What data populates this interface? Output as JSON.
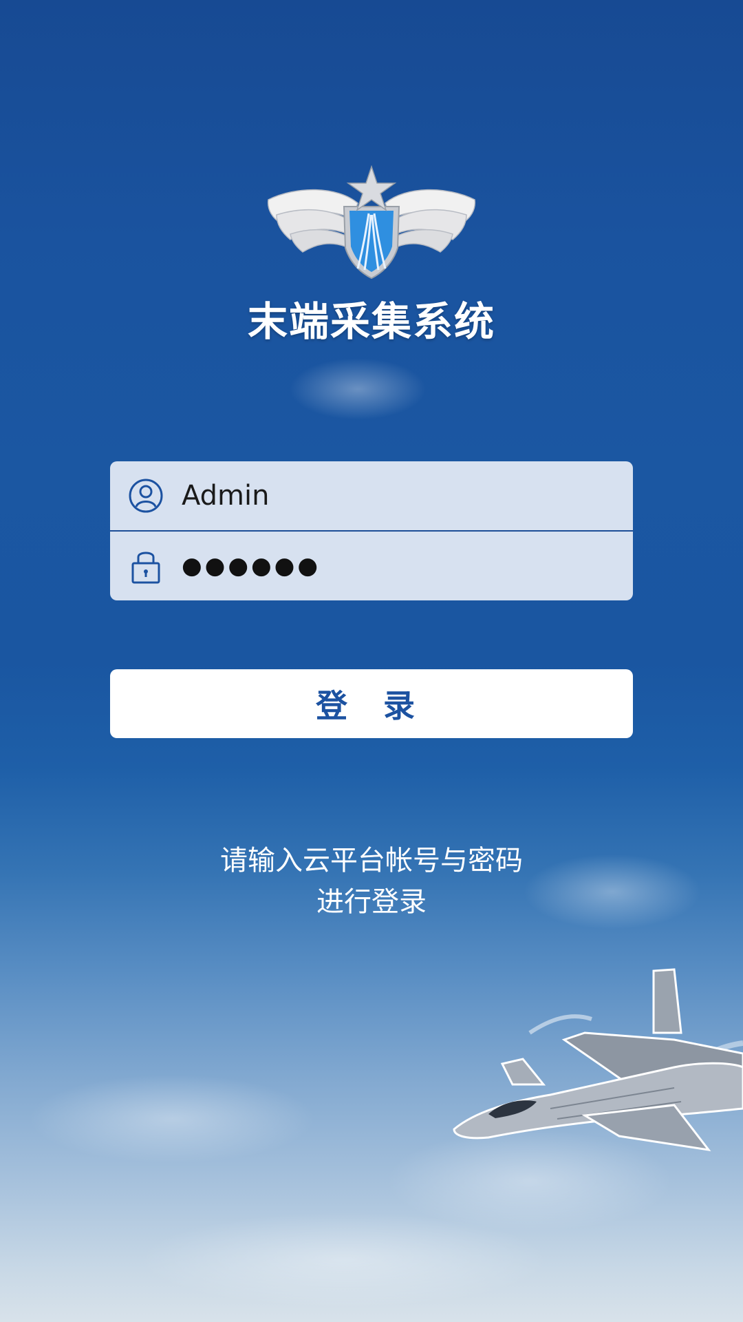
{
  "app": {
    "title": "末端采集系统"
  },
  "login_form": {
    "username": {
      "icon": "user-icon",
      "value": "Admin"
    },
    "password": {
      "icon": "lock-icon",
      "masked_value": "●●●●●●"
    },
    "submit_label": "登 录"
  },
  "hint": {
    "line1": "请输入云平台帐号与密码",
    "line2": "进行登录"
  },
  "colors": {
    "accent": "#1c52a1",
    "field_bg": "#e1e9f4",
    "button_bg": "#ffffff"
  }
}
